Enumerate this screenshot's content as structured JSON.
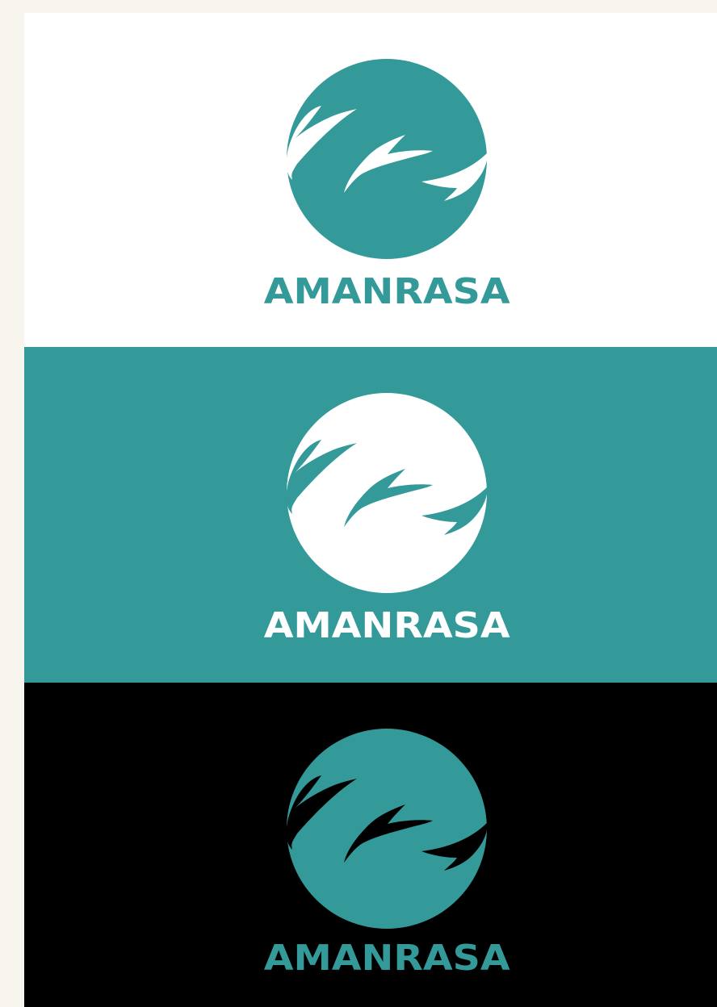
{
  "brand": {
    "name": "AMANRASA"
  },
  "colors": {
    "page_background": "#f8f4ee",
    "teal": "#339999",
    "white": "#ffffff",
    "black": "#000000"
  },
  "variants": [
    {
      "id": "light",
      "background": "#ffffff",
      "circle": "#339999",
      "leaves": "#ffffff",
      "text": "#339999"
    },
    {
      "id": "teal",
      "background": "#339999",
      "circle": "#ffffff",
      "leaves": "#339999",
      "text": "#ffffff"
    },
    {
      "id": "dark",
      "background": "#000000",
      "circle": "#339999",
      "leaves": "#000000",
      "text": "#339999"
    }
  ],
  "icons": {
    "logo_mark": "leaf-sprig-circle-icon"
  }
}
